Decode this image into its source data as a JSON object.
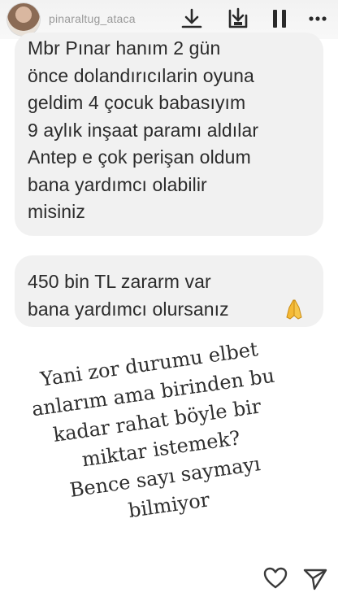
{
  "header": {
    "username": "pinaraltug_ataca"
  },
  "messages": [
    "Mbr Pınar hanım 2 gün\nönce dolandırıcılarin oyuna\ngeldim 4 çocuk babasıyım\n9 aylık inşaat paramı aldılar\nAntep e çok perişan oldum\nbana yardımcı olabilir\nmisiniz",
    "450 bin TL zararm var\nbana yardımcı olursanız"
  ],
  "caption": "Yani zor durumu elbet\nanlarım ama birinden bu\nkadar rahat böyle bir\nmiktar istemek?\nBence sayı saymayı\nbilmiyor"
}
